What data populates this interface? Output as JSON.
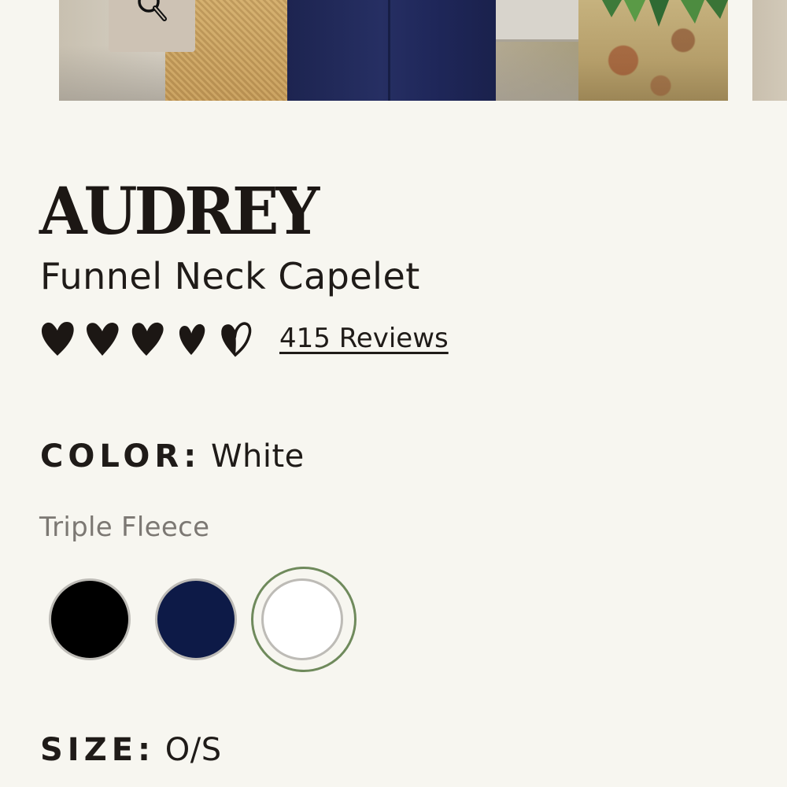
{
  "gallery": {
    "zoom_icon": "magnifier-icon"
  },
  "product": {
    "brand": "AUDREY",
    "name": "Funnel Neck Capelet",
    "rating": {
      "icon": "heart-icon",
      "value_out_of_5": 4.5,
      "reviews_link": "415 Reviews"
    }
  },
  "color_option": {
    "label": "COLOR:",
    "selected": "White",
    "fabric": "Triple Fleece",
    "swatches": [
      {
        "color": "#000000"
      },
      {
        "color": "#0d1a47"
      },
      {
        "color": "#ffffff"
      }
    ],
    "selected_ring_color": "#6f8a5c"
  },
  "size_option": {
    "label": "SIZE:",
    "selected": "O/S"
  },
  "colors": {
    "background": "#f7f6f0",
    "text": "#1e1a17",
    "muted_text": "#7c7873"
  }
}
